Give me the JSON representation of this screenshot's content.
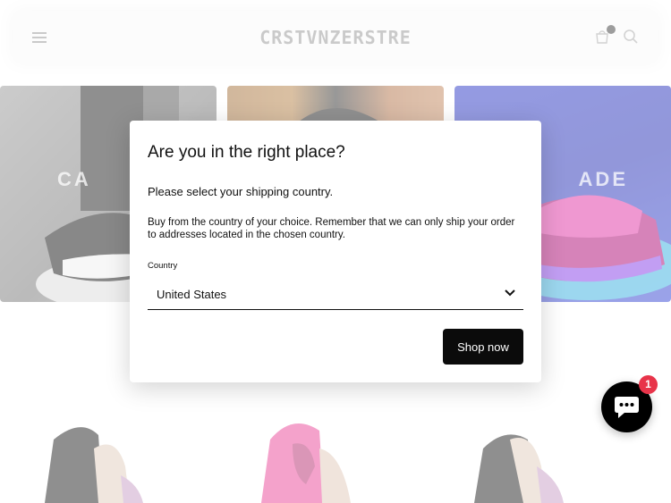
{
  "header": {
    "store_name": "CRSTVNZERSTRE",
    "icons": [
      "menu-icon",
      "cart-icon",
      "search-icon"
    ]
  },
  "tiles": [
    {
      "label": "CA"
    },
    {
      "label": ""
    },
    {
      "label": "ADE"
    }
  ],
  "modal": {
    "title": "Are you in the right place?",
    "subtitle": "Please select your shipping country.",
    "description": "Buy from the country of your choice. Remember that we can only ship your order to addresses located in the chosen country.",
    "country_label": "Country",
    "country_value": "United States",
    "shop_button": "Shop now"
  },
  "chat": {
    "badge_count": "1",
    "icon": "chat-bubble-icon",
    "background": "#000000",
    "badge_color": "#e8344a"
  }
}
